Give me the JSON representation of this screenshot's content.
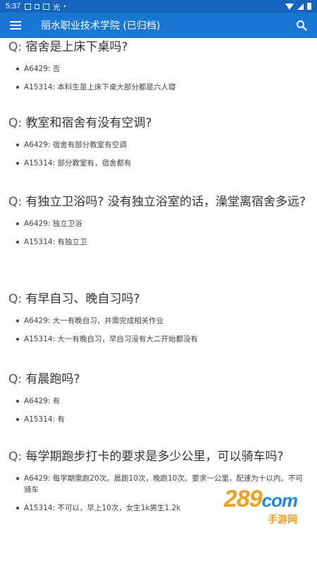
{
  "status_bar": {
    "time": "5:37",
    "indicator": "光"
  },
  "app_bar": {
    "title": "丽水职业技术学院 (已归档)",
    "menu_icon": "menu-icon",
    "search_icon": "search-icon"
  },
  "qa": [
    {
      "q_prefix": "Q:",
      "question": "宿舍是上床下桌吗?",
      "answers": [
        "A6429: 否",
        "A15314: 本科生是上床下桌大部分都是六人寝"
      ]
    },
    {
      "q_prefix": "Q:",
      "question": "教室和宿舍有没有空调?",
      "answers": [
        "A6429: 宿舍有部分教室有空调",
        "A15314: 部分教室有，宿舍都有"
      ]
    },
    {
      "q_prefix": "Q:",
      "question": "有独立卫浴吗? 没有独立浴室的话，澡堂离宿舍多远?",
      "answers": [
        "A6429: 独立卫浴",
        "A15314: 有独立卫"
      ]
    },
    {
      "q_prefix": "Q:",
      "question": "有早自习、晚自习吗?",
      "answers": [
        "A6429: 大一有晚自习，并需完成相关作业",
        "A15314: 大一有晚自习，早自习没有大二开始都没有"
      ]
    },
    {
      "q_prefix": "Q:",
      "question": "有晨跑吗?",
      "answers": [
        "A6429: 有",
        "A15314: 有"
      ]
    },
    {
      "q_prefix": "Q:",
      "question": "每学期跑步打卡的要求是多少公里，可以骑车吗?",
      "answers": [
        "A6429: 每学期需跑20次。晨跑10次，晚跑10次。要求一公里，配速为十以内。不可骑车",
        "A15314: 不可以，早上10次，女生1k男生1.2k"
      ]
    }
  ],
  "watermark": {
    "number": "289",
    "suffix": "com",
    "label": "手游网"
  },
  "colors": {
    "status_bar": "#1565c0",
    "app_bar": "#1976d2",
    "text": "#333333",
    "watermark_orange": "#f0a020",
    "watermark_blue": "#1e88e5"
  }
}
